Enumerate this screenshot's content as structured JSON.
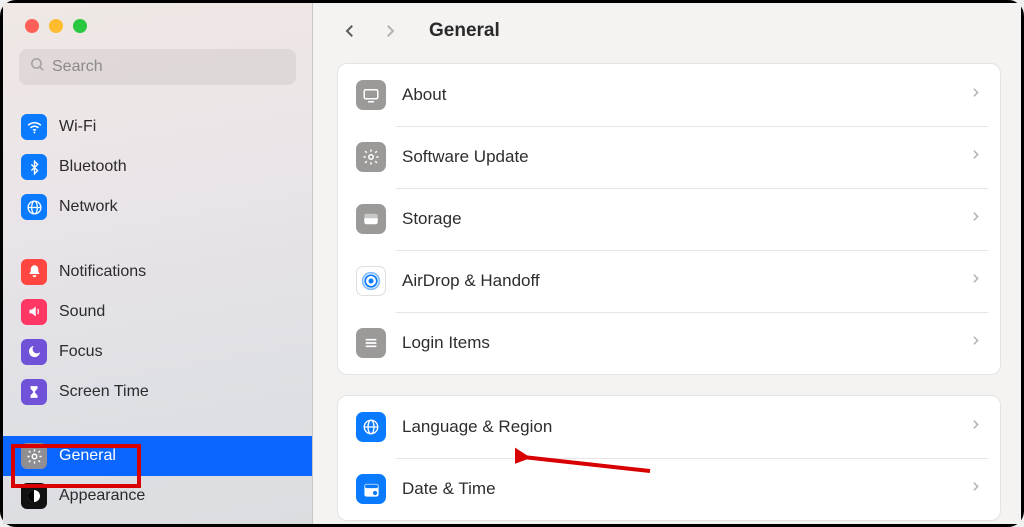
{
  "search": {
    "placeholder": "Search"
  },
  "header": {
    "title": "General"
  },
  "sidebar": {
    "items": [
      {
        "id": "wifi",
        "label": "Wi-Fi",
        "bg": "#0a7bff",
        "selected": false
      },
      {
        "id": "bluetooth",
        "label": "Bluetooth",
        "bg": "#0a7bff",
        "selected": false
      },
      {
        "id": "network",
        "label": "Network",
        "bg": "#0a7bff",
        "selected": false
      },
      {
        "id": "notifications",
        "label": "Notifications",
        "bg": "#ff4640",
        "selected": false
      },
      {
        "id": "sound",
        "label": "Sound",
        "bg": "#ff3764",
        "selected": false
      },
      {
        "id": "focus",
        "label": "Focus",
        "bg": "#6f52d8",
        "selected": false
      },
      {
        "id": "screentime",
        "label": "Screen Time",
        "bg": "#6f52d8",
        "selected": false
      },
      {
        "id": "general",
        "label": "General",
        "bg": "#8e8e93",
        "selected": true
      },
      {
        "id": "appearance",
        "label": "Appearance",
        "bg": "#121212",
        "selected": false
      }
    ]
  },
  "content": {
    "panels": [
      {
        "rows": [
          {
            "id": "about",
            "label": "About",
            "bg": "#9b9a99"
          },
          {
            "id": "software-update",
            "label": "Software Update",
            "bg": "#9b9a99"
          },
          {
            "id": "storage",
            "label": "Storage",
            "bg": "#9b9a99"
          },
          {
            "id": "airdrop-handoff",
            "label": "AirDrop & Handoff",
            "bg": "#ffffff"
          },
          {
            "id": "login-items",
            "label": "Login Items",
            "bg": "#9b9a99"
          }
        ]
      },
      {
        "rows": [
          {
            "id": "language-region",
            "label": "Language & Region",
            "bg": "#0a7bff"
          },
          {
            "id": "date-time",
            "label": "Date & Time",
            "bg": "#0a7bff"
          }
        ]
      }
    ]
  }
}
